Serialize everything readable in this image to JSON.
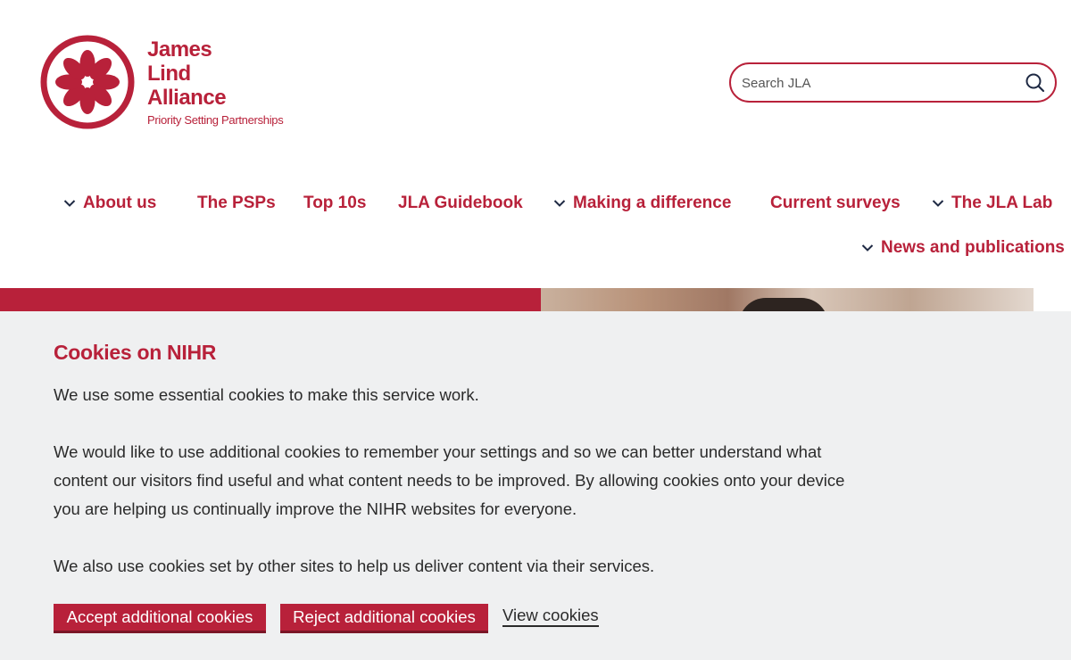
{
  "logo": {
    "name_line1": "James",
    "name_line2": "Lind",
    "name_line3": "Alliance",
    "subtitle": "Priority Setting Partnerships"
  },
  "search": {
    "placeholder": "Search JLA",
    "icon": "search-icon"
  },
  "nav": {
    "about": "About us",
    "psps": "The PSPs",
    "top10s": "Top 10s",
    "guidebook": "JLA Guidebook",
    "difference": "Making a difference",
    "surveys": "Current surveys",
    "lab": "The JLA Lab",
    "news": "News and publications"
  },
  "cookies": {
    "title": "Cookies on NIHR",
    "para1": "We use some essential cookies to make this service work.",
    "para2": "We would like to use additional cookies to remember your settings and so we can better understand what content our visitors find useful and what content needs to be improved. By allowing cookies onto your device you are helping us continually improve the NIHR websites for everyone.",
    "para3": "We also use cookies set by other sites to help us deliver content via their services.",
    "accept_label": "Accept additional cookies",
    "reject_label": "Reject additional cookies",
    "view_label": "View cookies"
  },
  "colors": {
    "brand": "#b8213a",
    "banner_bg": "#eff0f1",
    "text": "#2b2b2b"
  }
}
